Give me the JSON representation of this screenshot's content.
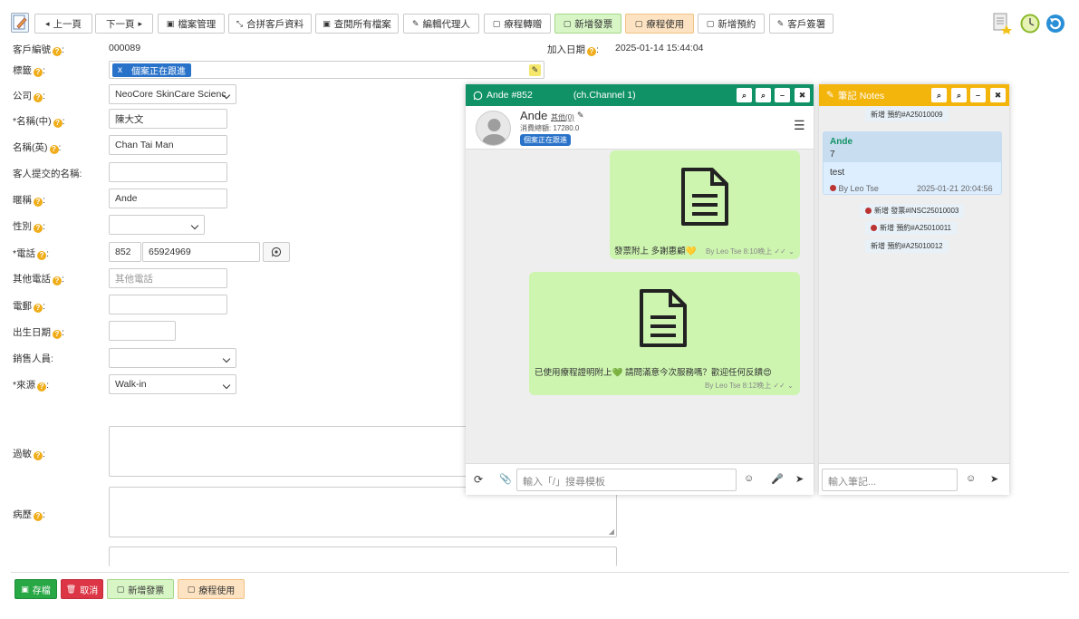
{
  "toolbar": {
    "prev": "上一頁",
    "next": "下一頁",
    "file_mgmt": "檔案管理",
    "merge": "合拼客戶資料",
    "view_files": "查閱所有檔案",
    "edit_agent": "編輯代理人",
    "course_transfer": "療程轉贈",
    "new_invoice": "新增發票",
    "course_use": "療程使用",
    "new_booking": "新增預約",
    "signature": "客戶簽署"
  },
  "form": {
    "client_no_label": "客戶編號",
    "client_no": "000089",
    "join_date_label": "加入日期",
    "join_date": "2025-01-14 15:44:04",
    "tags_label": "標籤",
    "tag": "個案正在跟進",
    "company_label": "公司",
    "company": "NeoCore SkinCare Scienc",
    "name_zh_label": "*名稱(中)",
    "name_zh": "陳大文",
    "name_en_label": "名稱(英)",
    "name_en": "Chan Tai Man",
    "submitted_name_label": "客人提交的名稱:",
    "nickname_label": "暱稱",
    "nickname": "Ande",
    "gender_label": "性別",
    "phone_label": "*電話",
    "phone_code": "852",
    "phone": "65924969",
    "other_phone_label": "其他電話",
    "other_phone_placeholder": "其他電話",
    "email_label": "電郵",
    "dob_label": "出生日期",
    "sales_label": "銷售人員:",
    "source_label": "*來源",
    "source": "Walk-in",
    "allergy_label": "過敏",
    "history_label": "病歷"
  },
  "chat": {
    "title": "Ande #852",
    "channel": "(ch.Channel 1)",
    "name": "Ande",
    "other": "其他(0)",
    "spend": "消費總額: 17280.0",
    "tag": "個案正在跟進",
    "msg1": "發票附上 多謝惠顧💛",
    "msg1_meta": "By Leo Tse 8:10晚上",
    "msg2": "已使用療程證明附上💚 請問滿意今次服務嗎？歡迎任何反饋😍",
    "msg2_meta": "By Leo Tse 8:12晚上",
    "input_placeholder": "輸入「/」搜尋模板"
  },
  "notes": {
    "title": "筆記 Notes",
    "item1": "新增 預約#A25010009",
    "note_author": "Ande",
    "note_line1": "7",
    "note_line2": "test",
    "note_by": "By Leo Tse",
    "note_time": "2025-01-21 20:04:56",
    "item2": "新增 發票#INSC25010003",
    "item3": "新增 預約#A25010011",
    "item4": "新增 預約#A25010012",
    "input_placeholder": "輸入筆記..."
  },
  "bottom": {
    "save": "存檔",
    "cancel": "取消",
    "new_invoice": "新增發票",
    "course_use": "療程使用"
  },
  "colors": {
    "chat_header": "#119266",
    "notes_header": "#f3b40c",
    "bubble": "#cdf5b0",
    "save": "#28a745",
    "cancel": "#dc3545"
  }
}
